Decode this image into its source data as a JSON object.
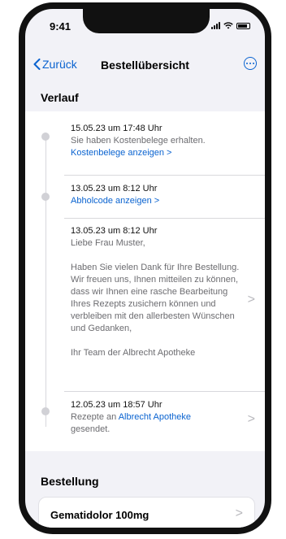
{
  "status_bar": {
    "time": "9:41"
  },
  "nav": {
    "back_label": "Zurück",
    "title": "Bestellübersicht"
  },
  "history": {
    "title": "Verlauf",
    "entries": [
      {
        "date": "15.05.23 um 17:48 Uhr",
        "text": "Sie haben Kostenbelege erhalten.",
        "link": "Kostenbelege anzeigen >"
      },
      {
        "date": "13.05.23 um 8:12 Uhr",
        "link": "Abholcode anzeigen >"
      },
      {
        "date": "13.05.23 um 8:12 Uhr",
        "greeting": "Liebe Frau Muster,",
        "body": "Haben Sie vielen Dank  für Ihre Bestellung. Wir freuen uns, Ihnen mitteilen zu können, dass wir Ihnen eine rasche Bearbeitung Ihres Rezepts zusichern können und verbleiben mit den allerbesten Wünschen und Gedanken,",
        "signature": "Ihr Team der Albrecht Apotheke"
      },
      {
        "date": "12.05.23 um 18:57 Uhr",
        "text_before": "Rezepte an",
        "pharmacy_link": "Albrecht Apotheke",
        "text_after": "gesendet."
      }
    ]
  },
  "order": {
    "title": "Bestellung",
    "items": [
      {
        "name": "Gematidolor 100mg"
      }
    ]
  },
  "chevron_glyph": ">",
  "colors": {
    "accent": "#0a63d0",
    "background": "#f2f2f7"
  }
}
